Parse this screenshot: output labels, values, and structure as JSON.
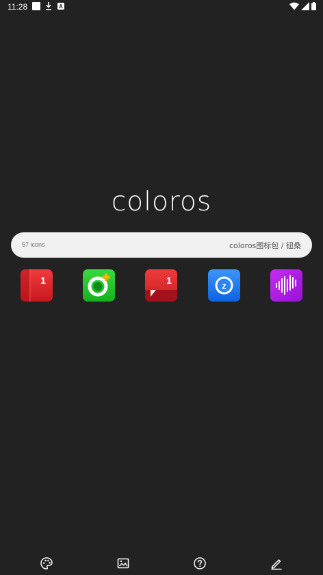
{
  "status_bar": {
    "time": "11:28",
    "notification_icons": [
      "square-icon",
      "download-icon",
      "a-icon"
    ],
    "system_icons": [
      "wifi-icon",
      "signal-icon",
      "battery-icon"
    ]
  },
  "logo": {
    "text": "coloros"
  },
  "info_bar": {
    "icon_count": "57 icons",
    "pack_info": "coloros图标包 / 钮桑"
  },
  "app_icons": [
    {
      "name": "red-book-icon",
      "badge": "1",
      "color": "#e0282e"
    },
    {
      "name": "green-ring-icon",
      "color": "#22c42a"
    },
    {
      "name": "red-message-icon",
      "badge": "1",
      "color": "#d8242a"
    },
    {
      "name": "blue-z-icon",
      "color": "#1e7cf2"
    },
    {
      "name": "purple-soundwave-icon",
      "color": "#b11ee6"
    }
  ],
  "bottom_nav": [
    {
      "name": "palette-icon"
    },
    {
      "name": "wallpaper-icon"
    },
    {
      "name": "help-icon"
    },
    {
      "name": "edit-icon"
    }
  ],
  "colors": {
    "background": "#222222",
    "info_bar_background": "#f1f1f1"
  }
}
